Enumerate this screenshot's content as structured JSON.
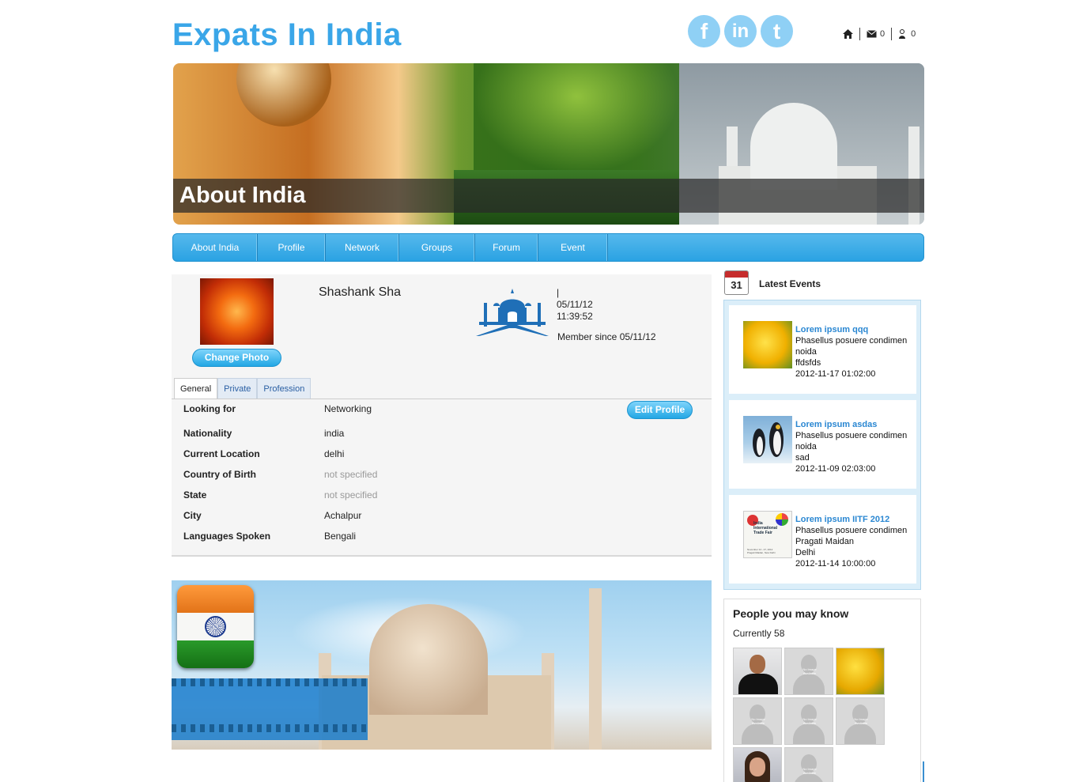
{
  "site": {
    "title": "Expats In India"
  },
  "social": {
    "facebook": "f",
    "linkedin": "in",
    "twitter": "t"
  },
  "topbar": {
    "messages_count": "0",
    "requests_count": "0"
  },
  "banner": {
    "caption": "About India"
  },
  "nav": {
    "items": [
      "About India",
      "Profile",
      "Network",
      "Groups",
      "Forum",
      "Event"
    ]
  },
  "profile": {
    "name": "Shashank Sha",
    "change_photo": "Change Photo",
    "meta_line1": "|",
    "meta_date": "05/11/12",
    "meta_time": "11:39:52",
    "member_since": "Member since 05/11/12",
    "tabs": [
      "General",
      "Private",
      "Profession"
    ],
    "edit_profile": "Edit Profile",
    "fields": [
      {
        "label": "Looking for",
        "value": "Networking"
      },
      {
        "label": "Nationality",
        "value": "india"
      },
      {
        "label": "Current Location",
        "value": "delhi"
      },
      {
        "label": "Country of Birth",
        "value": "not specified"
      },
      {
        "label": "State",
        "value": "not specified"
      },
      {
        "label": "City",
        "value": "Achalpur"
      },
      {
        "label": "Languages Spoken",
        "value": "Bengali"
      }
    ]
  },
  "events": {
    "calendar_day": "31",
    "title": "Latest Events",
    "items": [
      {
        "title": "Lorem ipsum qqq",
        "desc": "Phasellus posuere condimen",
        "place": "noida",
        "extra": "ffdsfds",
        "datetime": "2012-11-17 01:02:00"
      },
      {
        "title": "Lorem ipsum asdas",
        "desc": "Phasellus posuere condimen",
        "place": "noida",
        "extra": "sad",
        "datetime": "2012-11-09 02:03:00"
      },
      {
        "title": "Lorem ipsum IITF 2012",
        "desc": "Phasellus posuere condimen",
        "place": "Pragati Maidan",
        "extra": "Delhi",
        "datetime": "2012-11-14 10:00:00"
      }
    ],
    "iitf_thumb": {
      "line1": "India",
      "line2": "International",
      "line3": "Trade Fair",
      "footer1": "November 14 - 27, 2012",
      "footer2": "Pragati Maidan, New Delhi"
    }
  },
  "people": {
    "title": "People you may know",
    "count": "Currently 58",
    "no_image_label": "No Image Available"
  },
  "colors": {
    "accent": "#3aa6e8",
    "nav": "#2aa2e3",
    "event_title": "#2a87d2"
  }
}
